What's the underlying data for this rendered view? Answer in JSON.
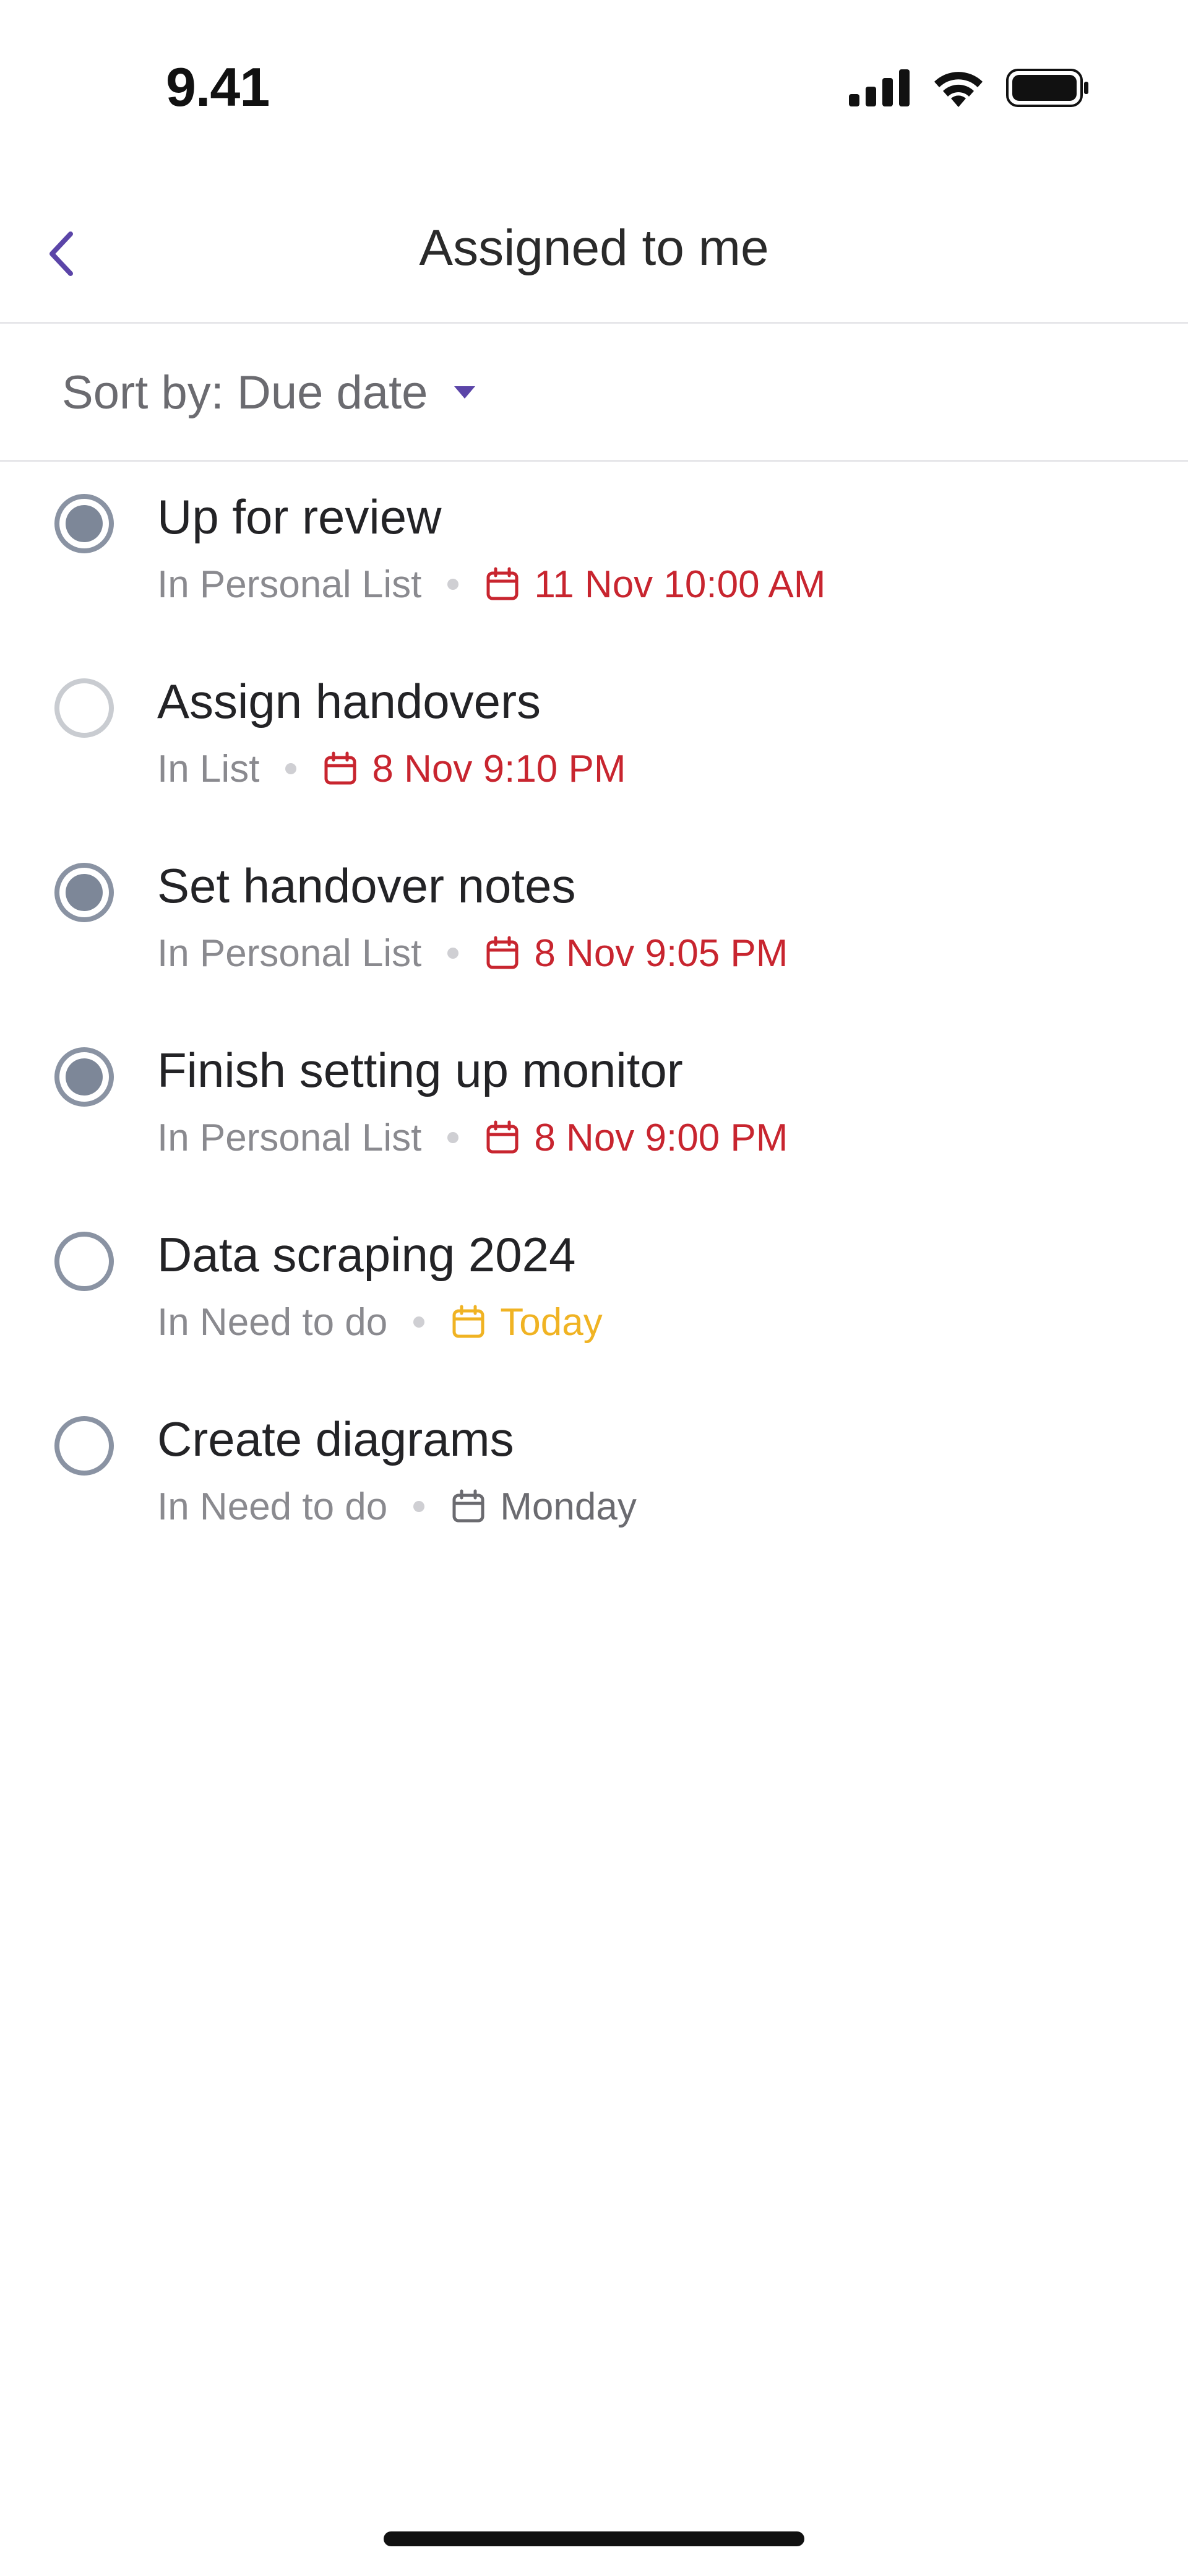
{
  "status_bar": {
    "time": "9.41"
  },
  "header": {
    "title": "Assigned to me"
  },
  "sort": {
    "label": "Sort by: Due date"
  },
  "colors": {
    "accent": "#5b45a8",
    "overdue": "#c8252f",
    "today": "#f0b323",
    "neutral": "#6b6b70",
    "check_ring": "#8a93a3",
    "check_ring_light": "#c9ccd1",
    "check_fill": "#7d8798"
  },
  "tasks": [
    {
      "title": "Up for review",
      "list": "In Personal List",
      "due": "11 Nov 10:00 AM",
      "due_state": "overdue",
      "check_state": "filled"
    },
    {
      "title": "Assign handovers",
      "list": "In List",
      "due": "8 Nov 9:10 PM",
      "due_state": "overdue",
      "check_state": "empty-light"
    },
    {
      "title": "Set handover notes",
      "list": "In Personal List",
      "due": "8 Nov 9:05 PM",
      "due_state": "overdue",
      "check_state": "filled"
    },
    {
      "title": "Finish setting up monitor",
      "list": "In Personal List",
      "due": "8 Nov 9:00 PM",
      "due_state": "overdue",
      "check_state": "filled"
    },
    {
      "title": "Data scraping 2024",
      "list": "In Need to do",
      "due": "Today",
      "due_state": "today",
      "check_state": "empty"
    },
    {
      "title": "Create diagrams",
      "list": "In Need to do",
      "due": "Monday",
      "due_state": "neutral",
      "check_state": "empty"
    }
  ],
  "icons": {
    "back": "chevron-left-icon",
    "sort_dropdown": "caret-down-icon",
    "calendar": "calendar-icon",
    "signal": "cellular-signal-icon",
    "wifi": "wifi-icon",
    "battery": "battery-icon"
  }
}
